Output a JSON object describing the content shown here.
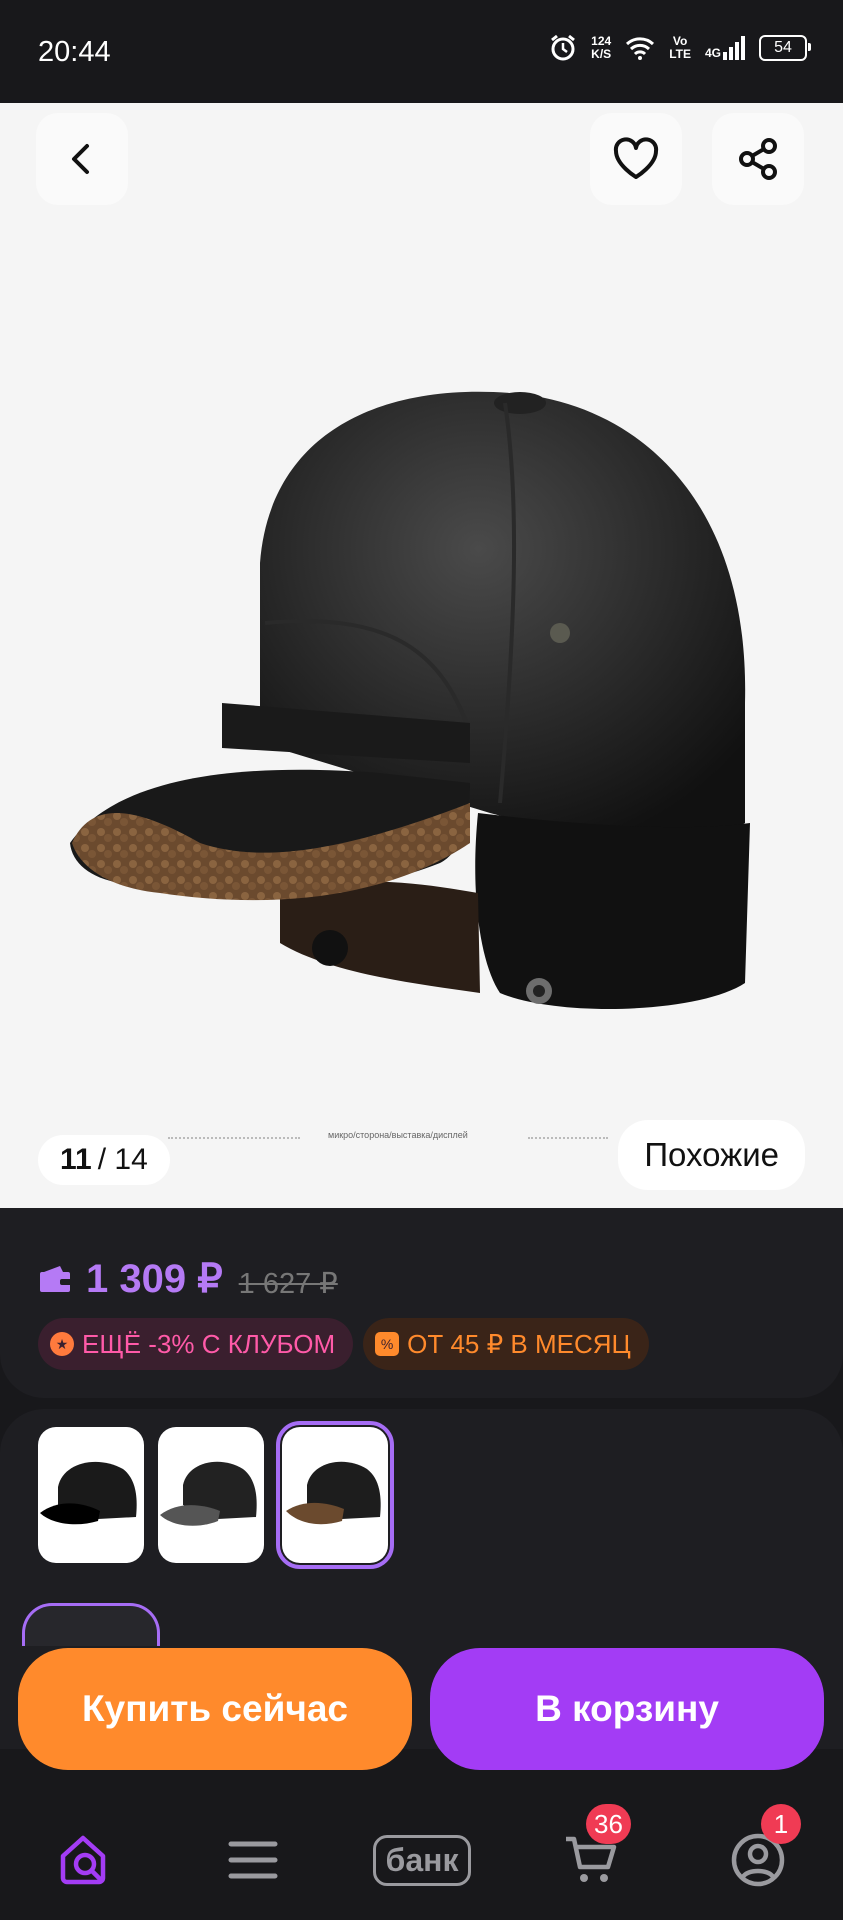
{
  "status_bar": {
    "time": "20:44",
    "net_speed_value": "124",
    "net_speed_unit": "K/S",
    "volte_top": "Vo",
    "volte_bottom": "LTE",
    "signal_label": "4G",
    "battery": "54"
  },
  "gallery": {
    "current": "11",
    "total": "/ 14",
    "similar_label": "Похожие",
    "caption": "микро/сторона/выставка/дисплей"
  },
  "price": {
    "current": "1 309 ₽",
    "old": "1 627 ₽",
    "club_badge": "ЕЩЁ -3% С КЛУБОМ",
    "month_badge": "ОТ 45 ₽ В МЕСЯЦ"
  },
  "colors": {
    "accent_purple": "#b57af5",
    "buy_orange": "#ff8a2c",
    "cart_purple": "#a33cf5",
    "badge_red": "#f03b54"
  },
  "actions": {
    "buy_now": "Купить сейчас",
    "add_to_cart": "В корзину"
  },
  "nav": {
    "bank_label": "банк",
    "cart_count": "36",
    "profile_count": "1"
  }
}
